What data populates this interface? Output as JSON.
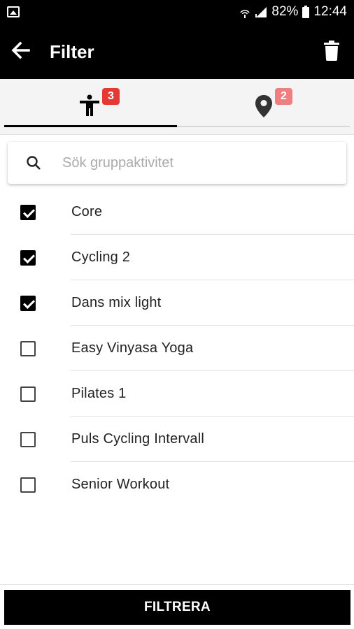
{
  "status_bar": {
    "battery_percent": "82%",
    "time": "12:44",
    "icons": [
      "image-icon",
      "wifi-calling-icon",
      "signal-icon",
      "battery-icon"
    ]
  },
  "app_bar": {
    "title": "Filter",
    "back_icon": "arrow-left-icon",
    "delete_icon": "trash-icon"
  },
  "tabs": [
    {
      "icon": "person-icon",
      "badge": "3",
      "selected": true
    },
    {
      "icon": "location-pin-icon",
      "badge": "2",
      "selected": false
    }
  ],
  "search": {
    "placeholder": "Sök gruppaktivitet",
    "value": ""
  },
  "activities": [
    {
      "label": "Core",
      "checked": true
    },
    {
      "label": "Cycling 2",
      "checked": true
    },
    {
      "label": "Dans mix light",
      "checked": true
    },
    {
      "label": "Easy Vinyasa Yoga",
      "checked": false
    },
    {
      "label": "Pilates 1",
      "checked": false
    },
    {
      "label": "Puls Cycling Intervall",
      "checked": false
    },
    {
      "label": "Senior Workout",
      "checked": false
    }
  ],
  "filter_button": {
    "label": "FILTRERA"
  },
  "colors": {
    "primary": "#000000",
    "badge_active": "#e53935",
    "badge_inactive": "#ef7f7f",
    "tab_background": "#f4f4f4"
  }
}
